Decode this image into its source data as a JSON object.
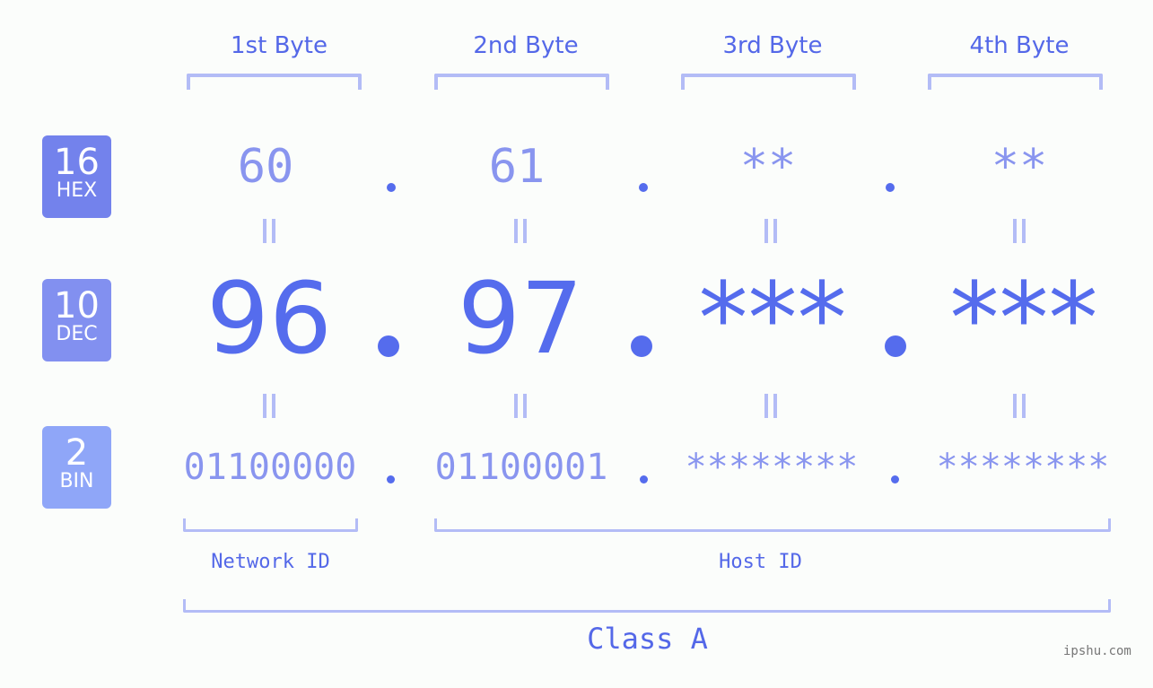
{
  "bytes": [
    {
      "header": "1st Byte",
      "hex": "60",
      "dec": "96",
      "bin": "01100000"
    },
    {
      "header": "2nd Byte",
      "hex": "61",
      "dec": "97",
      "bin": "01100001"
    },
    {
      "header": "3rd Byte",
      "hex": "**",
      "dec": "***",
      "bin": "********"
    },
    {
      "header": "4th Byte",
      "hex": "**",
      "dec": "***",
      "bin": "********"
    }
  ],
  "badges": {
    "hex": {
      "number": "16",
      "label": "HEX",
      "color": "#7382ec"
    },
    "dec": {
      "number": "10",
      "label": "DEC",
      "color": "#8290f0"
    },
    "bin": {
      "number": "2",
      "label": "BIN",
      "color": "#8fa6f8"
    }
  },
  "labels": {
    "network_id": "Network ID",
    "host_id": "Host ID",
    "class": "Class A"
  },
  "watermark": "ipshu.com",
  "colors": {
    "accent": "#556ced",
    "light_text": "#8995ef",
    "bracket": "#b3bcf6"
  }
}
